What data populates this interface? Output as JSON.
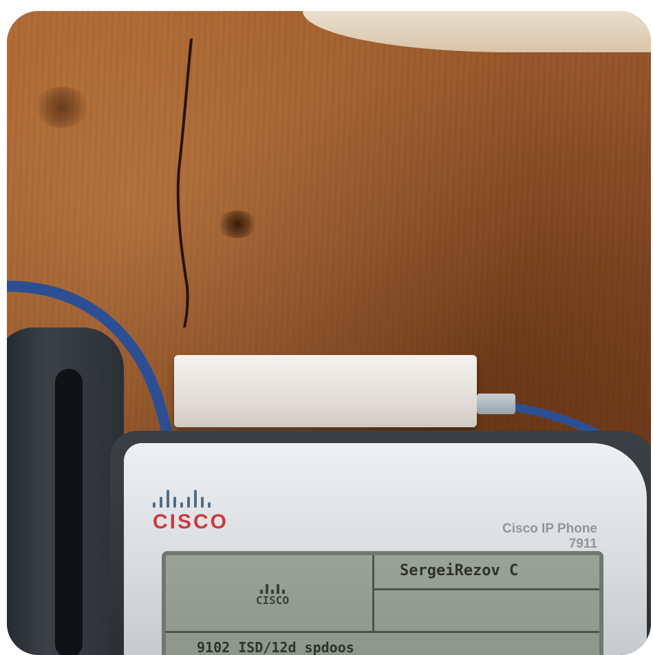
{
  "photo": {
    "subject": "Cisco IP phone under a wooden desk",
    "colors": {
      "wood": "#94552a",
      "cable": "#2c4f94",
      "cisco_red": "#c93a3e",
      "cisco_bars": "#4f6d86",
      "lcd_background": "#9aa398"
    }
  },
  "phone": {
    "brand": "CISCO",
    "model_line1": "Cisco IP Phone",
    "model_line2": "7911"
  },
  "lcd": {
    "top_right_text": "SergeiRezov C",
    "logo_text": "CISCO",
    "bottom_text": "9102 ISD/12d spdoos"
  }
}
